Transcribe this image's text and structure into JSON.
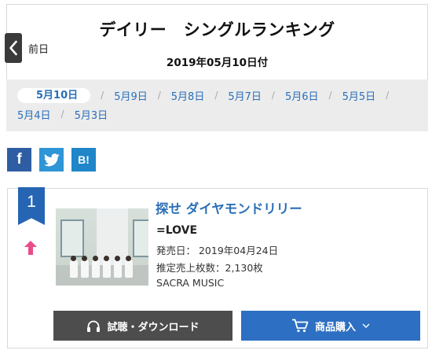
{
  "header": {
    "title": "デイリー　シングルランキング",
    "date": "2019年05月10日付",
    "prev_label": "前日"
  },
  "date_nav": {
    "active": "5月10日",
    "row1": [
      "5月9日",
      "5月8日",
      "5月7日",
      "5月6日",
      "5月5日"
    ],
    "row2": [
      "5月4日",
      "5月3日"
    ]
  },
  "share": {
    "facebook": "f",
    "hatena": "B!",
    "icons": [
      "facebook-icon",
      "twitter-icon",
      "hatena-bookmark-icon"
    ]
  },
  "entry": {
    "rank": "1",
    "trend_icon": "up-arrow-icon",
    "title": "探せ ダイヤモンドリリー",
    "artist": "=LOVE",
    "release": "発売日： 2019年04月24日",
    "sales": "推定売上枚数：2,130枚",
    "label": "SACRA MUSIC",
    "listen_button": "試聴・ダウンロード",
    "buy_button": "商品購入"
  },
  "colors": {
    "accent_blue": "#2a6fb8",
    "ribbon": "#2565b4",
    "trend_up": "#e84c8a",
    "listen_bg": "#4d4d4d",
    "buy_bg": "#2d6fc2"
  }
}
